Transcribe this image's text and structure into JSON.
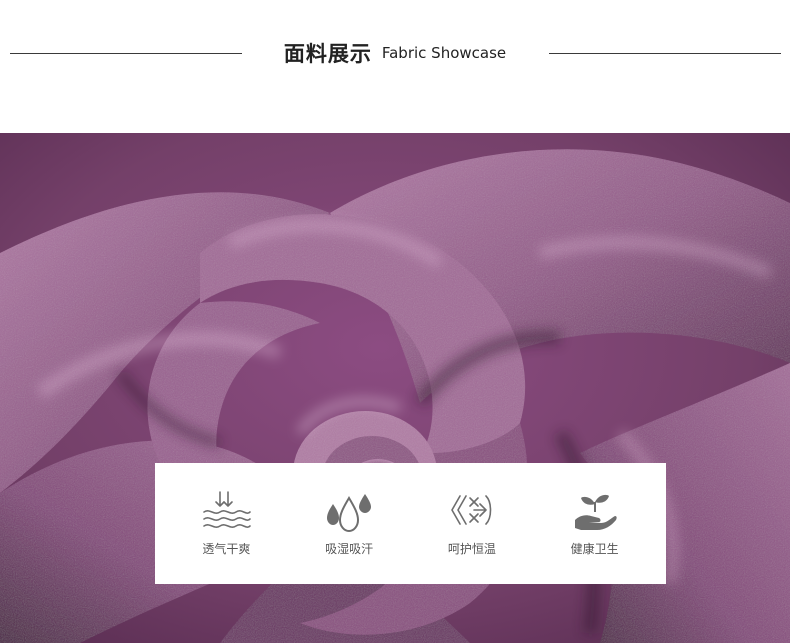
{
  "header": {
    "title_cn": "面料展示",
    "title_en": "Fabric Showcase"
  },
  "features": [
    {
      "icon": "breathable-dry-icon",
      "label": "透气干爽"
    },
    {
      "icon": "moisture-absorb-icon",
      "label": "吸湿吸汗"
    },
    {
      "icon": "warmth-protect-icon",
      "label": "呵护恒温"
    },
    {
      "icon": "healthy-hygiene-icon",
      "label": "健康卫生"
    }
  ],
  "colors": {
    "fabric_base": "#7a3f70",
    "fabric_highlight": "#b57aa8",
    "fabric_shadow": "#3f1d3a",
    "icon_gray": "#6e6e6e"
  }
}
